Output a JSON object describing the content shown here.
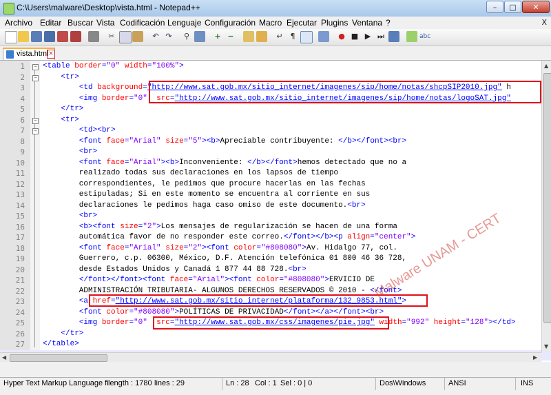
{
  "window": {
    "title": "C:\\Users\\malware\\Desktop\\vista.html - Notepad++",
    "minimize": "–",
    "maximize": "□",
    "close": "✕"
  },
  "menu": [
    "Archivo",
    "Editar",
    "Buscar",
    "Vista",
    "Codificación",
    "Lenguaje",
    "Configuración",
    "Macro",
    "Ejecutar",
    "Plugins",
    "Ventana",
    "?"
  ],
  "menu_close": "X",
  "toolbar_icons": [
    "new-file-icon",
    "open-file-icon",
    "save-icon",
    "save-all-icon",
    "close-icon",
    "close-all-icon",
    "print-icon",
    "cut-icon",
    "copy-icon",
    "paste-icon",
    "undo-icon",
    "redo-icon",
    "find-icon",
    "replace-icon",
    "zoom-in-icon",
    "zoom-out-icon",
    "sync-v-icon",
    "sync-h-icon",
    "word-wrap-icon",
    "all-chars-icon",
    "indent-guide-icon",
    "user-lang-icon",
    "record-macro-icon",
    "stop-record-icon",
    "play-macro-icon",
    "run-macro-multi-icon",
    "save-macro-icon",
    "spellcheck-icon",
    "abc-icon"
  ],
  "tab": {
    "label": "vista.html",
    "close": "×"
  },
  "lines": [
    {
      "n": "1",
      "segs": [
        [
          "tg",
          "<table "
        ],
        [
          "at",
          "border"
        ],
        [
          "tg",
          "="
        ],
        [
          "vl",
          "\"0\""
        ],
        [
          "tg",
          " "
        ],
        [
          "at",
          "width"
        ],
        [
          "tg",
          "="
        ],
        [
          "vl",
          "\"100%\""
        ],
        [
          "tg",
          ">"
        ]
      ]
    },
    {
      "n": "2",
      "segs": [
        [
          "tx",
          "    "
        ],
        [
          "tg",
          "<tr>"
        ]
      ]
    },
    {
      "n": "3",
      "segs": [
        [
          "tx",
          "        "
        ],
        [
          "tg",
          "<td "
        ],
        [
          "at",
          "background"
        ],
        [
          "tg",
          "="
        ],
        [
          "lk",
          "\"http://www.sat.gob.mx/sitio_internet/imagenes/sip/home/notas/shcpSIP2010.jpg\""
        ],
        [
          "tx",
          " h"
        ]
      ]
    },
    {
      "n": "4",
      "segs": [
        [
          "tx",
          "        "
        ],
        [
          "tg",
          "<img "
        ],
        [
          "at",
          "border"
        ],
        [
          "tg",
          "="
        ],
        [
          "vl",
          "\"0\""
        ],
        [
          "tx",
          "  "
        ],
        [
          "at",
          "src"
        ],
        [
          "tg",
          "="
        ],
        [
          "lk",
          "\"http://www.sat.gob.mx/sitio_internet/imagenes/sip/home/notas/logoSAT.jpg\""
        ]
      ]
    },
    {
      "n": "5",
      "segs": [
        [
          "tx",
          "    "
        ],
        [
          "tg",
          "</tr>"
        ]
      ]
    },
    {
      "n": "6",
      "segs": [
        [
          "tx",
          "    "
        ],
        [
          "tg",
          "<tr>"
        ]
      ]
    },
    {
      "n": "7",
      "segs": [
        [
          "tx",
          "        "
        ],
        [
          "tg",
          "<td><br>"
        ]
      ]
    },
    {
      "n": "8",
      "segs": [
        [
          "tx",
          "        "
        ],
        [
          "tg",
          "<font "
        ],
        [
          "at",
          "face"
        ],
        [
          "tg",
          "="
        ],
        [
          "vl",
          "\"Arial\""
        ],
        [
          "tg",
          " "
        ],
        [
          "at",
          "size"
        ],
        [
          "tg",
          "="
        ],
        [
          "vl",
          "\"5\""
        ],
        [
          "tg",
          "><b>"
        ],
        [
          "tx",
          "Apreciable contribuyente: "
        ],
        [
          "tg",
          "</b></font><br>"
        ]
      ]
    },
    {
      "n": "9",
      "segs": [
        [
          "tx",
          "        "
        ],
        [
          "tg",
          "<br>"
        ]
      ]
    },
    {
      "n": "10",
      "segs": [
        [
          "tx",
          "        "
        ],
        [
          "tg",
          "<font "
        ],
        [
          "at",
          "face"
        ],
        [
          "tg",
          "="
        ],
        [
          "vl",
          "\"Arial\""
        ],
        [
          "tg",
          "><b>"
        ],
        [
          "tx",
          "Inconveniente: "
        ],
        [
          "tg",
          "</b></font>"
        ],
        [
          "tx",
          "hemos detectado que no a"
        ]
      ]
    },
    {
      "n": "11",
      "segs": [
        [
          "tx",
          "        realizado todas sus declaraciones en los lapsos de tiempo"
        ]
      ]
    },
    {
      "n": "12",
      "segs": [
        [
          "tx",
          "        correspondientes, le pedimos que procure hacerlas en las fechas"
        ]
      ]
    },
    {
      "n": "13",
      "segs": [
        [
          "tx",
          "        estipuladas; Si en este momento se encuentra al corriente en sus"
        ]
      ]
    },
    {
      "n": "14",
      "segs": [
        [
          "tx",
          "        declaraciones le pedimos haga caso omiso de este documento."
        ],
        [
          "tg",
          "<br>"
        ]
      ]
    },
    {
      "n": "15",
      "segs": [
        [
          "tx",
          "        "
        ],
        [
          "tg",
          "<br>"
        ]
      ]
    },
    {
      "n": "16",
      "segs": [
        [
          "tx",
          "        "
        ],
        [
          "tg",
          "<b><font "
        ],
        [
          "at",
          "size"
        ],
        [
          "tg",
          "="
        ],
        [
          "vl",
          "\"2\""
        ],
        [
          "tg",
          ">"
        ],
        [
          "tx",
          "Los mensajes de regularización se hacen de una forma"
        ]
      ]
    },
    {
      "n": "17",
      "segs": [
        [
          "tx",
          "        automática favor de no responder este correo."
        ],
        [
          "tg",
          "</font></b><p "
        ],
        [
          "at",
          "align"
        ],
        [
          "tg",
          "="
        ],
        [
          "vl",
          "\"center\""
        ],
        [
          "tg",
          ">"
        ]
      ]
    },
    {
      "n": "18",
      "segs": [
        [
          "tx",
          "        "
        ],
        [
          "tg",
          "<font "
        ],
        [
          "at",
          "face"
        ],
        [
          "tg",
          "="
        ],
        [
          "vl",
          "\"Arial\""
        ],
        [
          "tg",
          " "
        ],
        [
          "at",
          "size"
        ],
        [
          "tg",
          "="
        ],
        [
          "vl",
          "\"2\""
        ],
        [
          "tg",
          "><font "
        ],
        [
          "at",
          "color"
        ],
        [
          "tg",
          "="
        ],
        [
          "vl",
          "\"#808080\""
        ],
        [
          "tg",
          ">"
        ],
        [
          "tx",
          "Av. Hidalgo 77, col."
        ]
      ]
    },
    {
      "n": "19",
      "segs": [
        [
          "tx",
          "        Guerrero, c.p. 06300, México, D.F. Atención telefónica 01 800 46 36 728,"
        ]
      ]
    },
    {
      "n": "20",
      "segs": [
        [
          "tx",
          "        desde Estados Unidos y Canadá 1 877 44 88 728."
        ],
        [
          "tg",
          "<br>"
        ]
      ]
    },
    {
      "n": "21",
      "segs": [
        [
          "tx",
          "        "
        ],
        [
          "tg",
          "</font></font><font "
        ],
        [
          "at",
          "face"
        ],
        [
          "tg",
          "="
        ],
        [
          "vl",
          "\"Arial\""
        ],
        [
          "tg",
          "><font "
        ],
        [
          "at",
          "color"
        ],
        [
          "tg",
          "="
        ],
        [
          "vl",
          "\"#808080\""
        ],
        [
          "tg",
          ">"
        ],
        [
          "tx",
          "ERVICIO DE"
        ]
      ]
    },
    {
      "n": "22",
      "segs": [
        [
          "tx",
          "        ADMINISTRACIÓN TRIBUTARIA- ALGUNOS DERECHOS RESERVADOS © 2010 - "
        ],
        [
          "tg",
          "</font>"
        ]
      ]
    },
    {
      "n": "23",
      "segs": [
        [
          "tx",
          "        "
        ],
        [
          "tg",
          "<a "
        ],
        [
          "at",
          "href"
        ],
        [
          "tg",
          "="
        ],
        [
          "lk",
          "\"http://www.sat.gob.mx/sitio_internet/plataforma/132_9853.html\""
        ],
        [
          "tg",
          ">"
        ]
      ]
    },
    {
      "n": "24",
      "segs": [
        [
          "tx",
          "        "
        ],
        [
          "tg",
          "<font "
        ],
        [
          "at",
          "color"
        ],
        [
          "tg",
          "="
        ],
        [
          "vl",
          "\"#808080\""
        ],
        [
          "tg",
          ">"
        ],
        [
          "tx",
          "POLÍTICAS DE PRIVACIDAD"
        ],
        [
          "tg",
          "</font></a></font><br>"
        ]
      ]
    },
    {
      "n": "25",
      "segs": [
        [
          "tx",
          "        "
        ],
        [
          "tg",
          "<img "
        ],
        [
          "at",
          "border"
        ],
        [
          "tg",
          "="
        ],
        [
          "vl",
          "\"0\""
        ],
        [
          "tx",
          "  "
        ],
        [
          "at",
          "src"
        ],
        [
          "tg",
          "="
        ],
        [
          "lk",
          "\"http://www.sat.gob.mx/css/imagenes/pie.jpg\""
        ],
        [
          "tx",
          " "
        ],
        [
          "at",
          "width"
        ],
        [
          "tg",
          "="
        ],
        [
          "vl",
          "\"992\""
        ],
        [
          "tg",
          " "
        ],
        [
          "at",
          "height"
        ],
        [
          "tg",
          "="
        ],
        [
          "vl",
          "\"128\""
        ],
        [
          "tg",
          "></td>"
        ]
      ]
    },
    {
      "n": "26",
      "segs": [
        [
          "tx",
          "    "
        ],
        [
          "tg",
          "</tr>"
        ]
      ]
    },
    {
      "n": "27",
      "segs": [
        [
          "tg",
          "</table>"
        ]
      ]
    },
    {
      "n": "28",
      "segs": []
    }
  ],
  "watermark": "Malware UNAM - CERT",
  "status": {
    "language": "Hyper Text Markup Language fi",
    "length": "length : 1780",
    "lines": "lines : 29",
    "ln": "Ln : 28",
    "col": "Col : 1",
    "sel": "Sel : 0 | 0",
    "eol": "Dos\\Windows",
    "encoding": "ANSI",
    "mode": "INS"
  },
  "colors": {
    "tag": "#0000ff",
    "attr": "#ff0000",
    "value": "#8000ff",
    "highlight": "#e0101a"
  }
}
